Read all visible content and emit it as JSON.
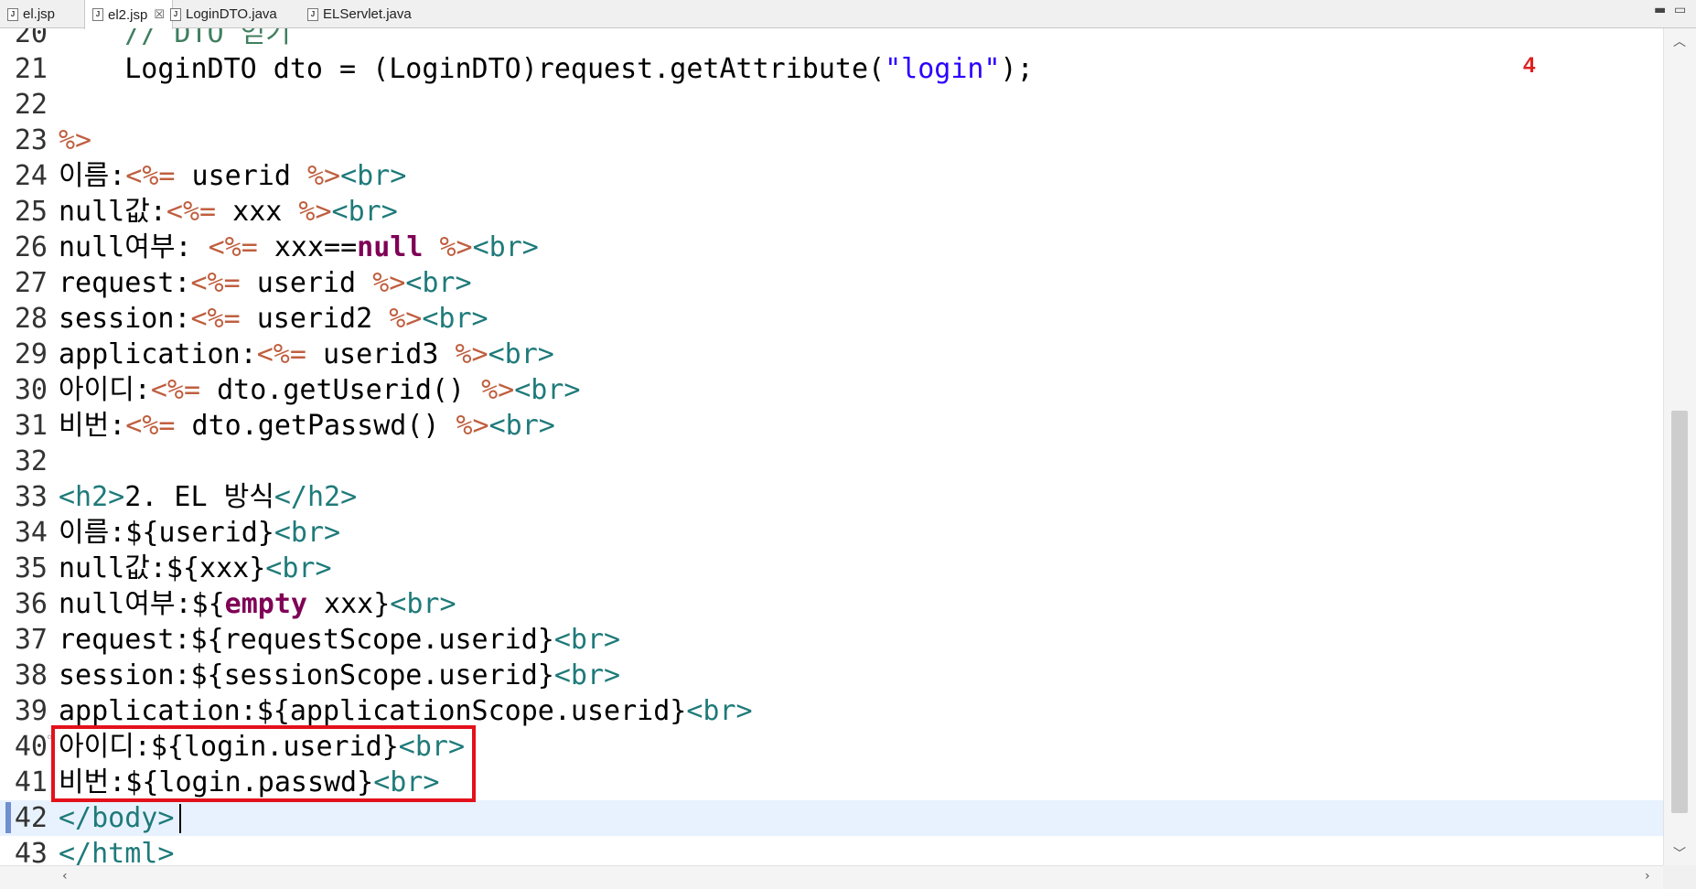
{
  "tabs": [
    {
      "label": "el.jsp",
      "icon": "jsp-file-icon",
      "active": false
    },
    {
      "label": "el2.jsp",
      "icon": "jsp-file-icon",
      "active": true,
      "close": "☒"
    },
    {
      "label": "LoginDTO.java",
      "icon": "java-file-icon",
      "active": false
    },
    {
      "label": "ELServlet.java",
      "icon": "java-file-icon",
      "active": false
    }
  ],
  "window_controls": {
    "minimize": "▬",
    "maximize": "▭"
  },
  "annotation": {
    "number": "4",
    "color": "#e3111b"
  },
  "lines": [
    {
      "n": "20",
      "segs": [
        {
          "t": "    // DTO 얻기",
          "c": "cmt"
        }
      ]
    },
    {
      "n": "21",
      "segs": [
        {
          "t": "    LoginDTO dto = (LoginDTO)request.getAttribute(",
          "c": ""
        },
        {
          "t": "\"login\"",
          "c": "str"
        },
        {
          "t": ");",
          "c": ""
        }
      ]
    },
    {
      "n": "22",
      "segs": []
    },
    {
      "n": "23",
      "segs": [
        {
          "t": "%>",
          "c": "jsp"
        }
      ]
    },
    {
      "n": "24",
      "segs": [
        {
          "t": "이름:",
          "c": ""
        },
        {
          "t": "<%=",
          "c": "jsp"
        },
        {
          "t": " userid ",
          "c": ""
        },
        {
          "t": "%>",
          "c": "jsp"
        },
        {
          "t": "<br>",
          "c": "tag"
        }
      ]
    },
    {
      "n": "25",
      "segs": [
        {
          "t": "null값:",
          "c": ""
        },
        {
          "t": "<%=",
          "c": "jsp"
        },
        {
          "t": " xxx ",
          "c": ""
        },
        {
          "t": "%>",
          "c": "jsp"
        },
        {
          "t": "<br>",
          "c": "tag"
        }
      ]
    },
    {
      "n": "26",
      "segs": [
        {
          "t": "null여부: ",
          "c": ""
        },
        {
          "t": "<%=",
          "c": "jsp"
        },
        {
          "t": " xxx==",
          "c": ""
        },
        {
          "t": "null",
          "c": "kw"
        },
        {
          "t": " ",
          "c": ""
        },
        {
          "t": "%>",
          "c": "jsp"
        },
        {
          "t": "<br>",
          "c": "tag"
        }
      ]
    },
    {
      "n": "27",
      "segs": [
        {
          "t": "request:",
          "c": ""
        },
        {
          "t": "<%=",
          "c": "jsp"
        },
        {
          "t": " userid ",
          "c": ""
        },
        {
          "t": "%>",
          "c": "jsp"
        },
        {
          "t": "<br>",
          "c": "tag"
        }
      ]
    },
    {
      "n": "28",
      "segs": [
        {
          "t": "session:",
          "c": ""
        },
        {
          "t": "<%=",
          "c": "jsp"
        },
        {
          "t": " userid2 ",
          "c": ""
        },
        {
          "t": "%>",
          "c": "jsp"
        },
        {
          "t": "<br>",
          "c": "tag"
        }
      ]
    },
    {
      "n": "29",
      "segs": [
        {
          "t": "application:",
          "c": ""
        },
        {
          "t": "<%=",
          "c": "jsp"
        },
        {
          "t": " userid3 ",
          "c": ""
        },
        {
          "t": "%>",
          "c": "jsp"
        },
        {
          "t": "<br>",
          "c": "tag"
        }
      ]
    },
    {
      "n": "30",
      "segs": [
        {
          "t": "아이디:",
          "c": ""
        },
        {
          "t": "<%=",
          "c": "jsp"
        },
        {
          "t": " dto.getUserid() ",
          "c": ""
        },
        {
          "t": "%>",
          "c": "jsp"
        },
        {
          "t": "<br>",
          "c": "tag"
        }
      ]
    },
    {
      "n": "31",
      "segs": [
        {
          "t": "비번:",
          "c": ""
        },
        {
          "t": "<%=",
          "c": "jsp"
        },
        {
          "t": " dto.getPasswd() ",
          "c": ""
        },
        {
          "t": "%>",
          "c": "jsp"
        },
        {
          "t": "<br>",
          "c": "tag"
        }
      ]
    },
    {
      "n": "32",
      "segs": []
    },
    {
      "n": "33",
      "segs": [
        {
          "t": "<h2>",
          "c": "tag"
        },
        {
          "t": "2. EL 방식",
          "c": ""
        },
        {
          "t": "</h2>",
          "c": "tag"
        }
      ]
    },
    {
      "n": "34",
      "segs": [
        {
          "t": "이름:${userid}",
          "c": ""
        },
        {
          "t": "<br>",
          "c": "tag"
        }
      ]
    },
    {
      "n": "35",
      "segs": [
        {
          "t": "null값:${xxx}",
          "c": ""
        },
        {
          "t": "<br>",
          "c": "tag"
        }
      ]
    },
    {
      "n": "36",
      "segs": [
        {
          "t": "null여부:${",
          "c": ""
        },
        {
          "t": "empty",
          "c": "kw"
        },
        {
          "t": " xxx}",
          "c": ""
        },
        {
          "t": "<br>",
          "c": "tag"
        }
      ]
    },
    {
      "n": "37",
      "segs": [
        {
          "t": "request:${requestScope.userid}",
          "c": ""
        },
        {
          "t": "<br>",
          "c": "tag"
        }
      ]
    },
    {
      "n": "38",
      "segs": [
        {
          "t": "session:${sessionScope.userid}",
          "c": ""
        },
        {
          "t": "<br>",
          "c": "tag"
        }
      ]
    },
    {
      "n": "39",
      "segs": [
        {
          "t": "application:${applicationScope.userid}",
          "c": ""
        },
        {
          "t": "<br>",
          "c": "tag"
        }
      ]
    },
    {
      "n": "40",
      "segs": [
        {
          "t": "아이디:${login.userid}",
          "c": ""
        },
        {
          "t": "<br>",
          "c": "tag"
        }
      ]
    },
    {
      "n": "41",
      "segs": [
        {
          "t": "비번:${login.passwd}",
          "c": ""
        },
        {
          "t": "<br>",
          "c": "tag"
        }
      ]
    },
    {
      "n": "42",
      "segs": [
        {
          "t": "</body>",
          "c": "tag"
        }
      ],
      "current": true
    },
    {
      "n": "43",
      "segs": [
        {
          "t": "</html>",
          "c": "tag"
        }
      ]
    }
  ]
}
